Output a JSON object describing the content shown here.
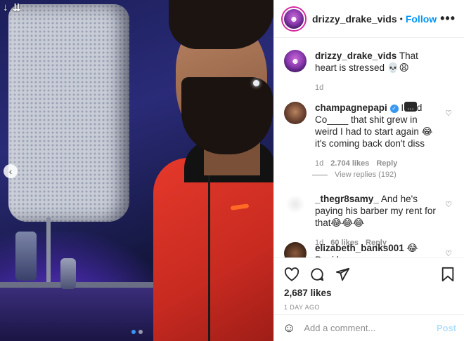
{
  "post": {
    "author": "drizzy_drake_vids",
    "follow_label": "Follow",
    "separator": "•",
    "more": "•••",
    "caption": "That heart is stressed 💀😩",
    "caption_age": "1d"
  },
  "comments": [
    {
      "user": "champagnepapi",
      "verified": true,
      "text": "I had Co____ that shit grew in weird I had to start again 😂 it's coming back don't diss",
      "age": "1d",
      "likes": "2.704 likes",
      "reply": "Reply",
      "overlay": "..."
    },
    {
      "user": "_thegr8samy_",
      "verified": false,
      "text": "And he's paying his barber my rent for that😂😂😂",
      "age": "1d",
      "likes": "60 likes",
      "reply": "Reply"
    },
    {
      "user": "elizabeth_banks001",
      "verified": false,
      "text": "😂 Papi has",
      "age": "",
      "likes": "",
      "reply": ""
    }
  ],
  "view_replies": "View replies (192)",
  "likes_total": "2,687 likes",
  "posted": "1 DAY AGO",
  "add_comment_placeholder": "Add a comment...",
  "post_button": "Post",
  "colors": {
    "link": "#0095f6",
    "post_disabled": "#b2dffc",
    "muted": "#8e8e8e"
  },
  "icons": [
    "download-icon",
    "chevron-left-icon",
    "heart-icon",
    "comment-icon",
    "share-icon",
    "bookmark-icon",
    "emoji-icon",
    "more-icon"
  ]
}
